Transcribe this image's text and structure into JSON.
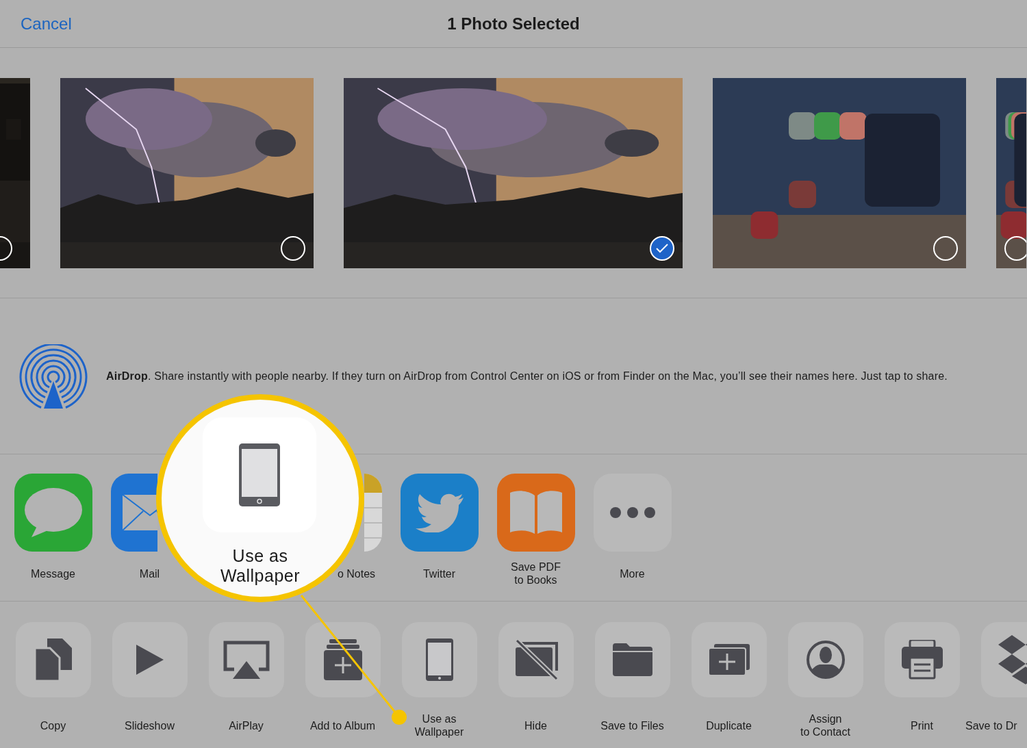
{
  "header": {
    "cancel": "Cancel",
    "title": "1 Photo Selected"
  },
  "photos": [
    {
      "kind": "picture",
      "selected": false
    },
    {
      "kind": "picture",
      "selected": false
    },
    {
      "kind": "picture",
      "selected": true
    },
    {
      "kind": "picture",
      "selected": false
    },
    {
      "kind": "picture",
      "selected": false
    }
  ],
  "airdrop": {
    "text": "**AirDrop**. Share instantly with people nearby. If they turn on AirDrop from Control Center on iOS or from Finder on the Mac, you’ll see their names here. Just tap to share."
  },
  "apps": [
    {
      "kind": "message",
      "label": "Message"
    },
    {
      "kind": "mail",
      "label": "Mail"
    },
    {
      "kind": "notes",
      "label": "o Notes"
    },
    {
      "kind": "twitter",
      "label": "Twitter"
    },
    {
      "kind": "books",
      "label": "Save PDF\nto Books"
    },
    {
      "kind": "more",
      "label": "More"
    }
  ],
  "actions": [
    {
      "kind": "copy",
      "label": "Copy"
    },
    {
      "kind": "slideshow",
      "label": "Slideshow"
    },
    {
      "kind": "airplay",
      "label": "AirPlay"
    },
    {
      "kind": "album",
      "label": "Add to Album"
    },
    {
      "kind": "wallpaper",
      "label": "Use as\nWallpaper"
    },
    {
      "kind": "hide",
      "label": "Hide"
    },
    {
      "kind": "files",
      "label": "Save to Files"
    },
    {
      "kind": "duplicate",
      "label": "Duplicate"
    },
    {
      "kind": "contact",
      "label": "Assign\nto Contact"
    },
    {
      "kind": "print",
      "label": "Print"
    },
    {
      "kind": "dropbox",
      "label": "Save to Dr"
    }
  ],
  "callout": {
    "label": "Use as\nWallpaper"
  }
}
